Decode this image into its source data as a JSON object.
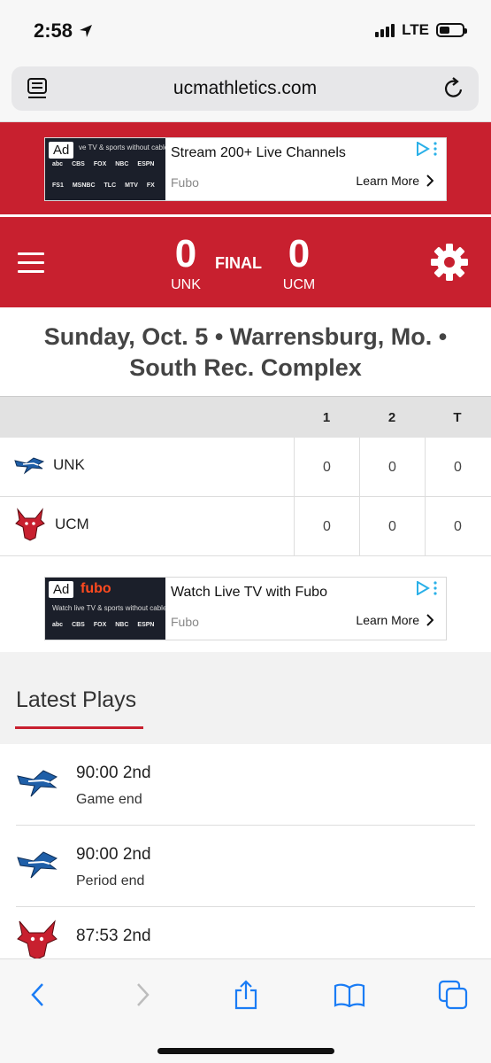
{
  "status_bar": {
    "time": "2:58",
    "network": "LTE",
    "battery_level": 0.45
  },
  "browser": {
    "url": "ucmathletics.com"
  },
  "ad_top": {
    "badge": "Ad",
    "thumb_text": "ve TV & sports without cable",
    "logos_row1": [
      "abc",
      "CBS",
      "FOX",
      "NBC",
      "ESPN"
    ],
    "logos_row2": [
      "FS1",
      "MSNBC",
      "TLC",
      "MTV",
      "FX"
    ],
    "headline": "Stream 200+ Live Channels",
    "brand": "Fubo",
    "cta": "Learn More"
  },
  "score": {
    "home_team": "UNK",
    "home_score": "0",
    "status": "FINAL",
    "away_team": "UCM",
    "away_score": "0"
  },
  "game_info": {
    "line1": "Sunday, Oct. 5 • Warrensburg, Mo. •",
    "line2": "South Rec. Complex"
  },
  "linescore": {
    "headers": [
      "1",
      "2",
      "T"
    ],
    "rows": [
      {
        "team": "UNK",
        "values": [
          "0",
          "0",
          "0"
        ]
      },
      {
        "team": "UCM",
        "values": [
          "0",
          "0",
          "0"
        ]
      }
    ]
  },
  "ad_bottom": {
    "badge": "Ad",
    "logo": "fubo",
    "thumb_text": "Watch live TV & sports without cable",
    "logos_row1": [
      "abc",
      "CBS",
      "FOX",
      "NBC",
      "ESPN"
    ],
    "headline": "Watch Live TV with Fubo",
    "brand": "Fubo",
    "cta": "Learn More"
  },
  "latest_plays": {
    "title": "Latest Plays",
    "items": [
      {
        "time": "90:00 2nd",
        "desc": "Game end",
        "team": "UNK"
      },
      {
        "time": "90:00 2nd",
        "desc": "Period end",
        "team": "UNK"
      },
      {
        "time": "87:53 2nd",
        "desc": "",
        "team": "UCM"
      }
    ]
  },
  "colors": {
    "brand_red": "#c8202f",
    "unk_blue": "#1f5fa8",
    "ios_blue": "#1a7cf5"
  }
}
